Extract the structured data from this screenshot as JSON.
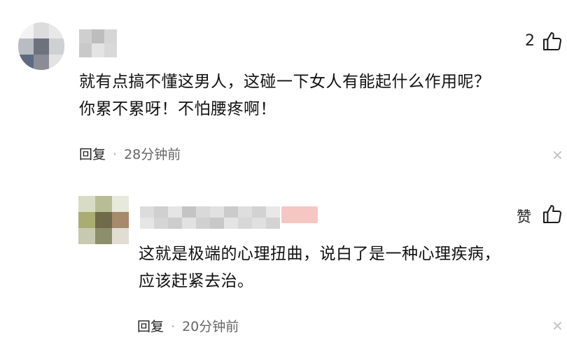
{
  "comment": {
    "like_count": "2",
    "text_line1": "就有点搞不懂这男人，这碰一下女人有能起什么作用呢？",
    "text_line2": "你累不累呀！不怕腰疼啊！",
    "reply_label": "回复",
    "time": "28分钟前"
  },
  "reply": {
    "like_label": "赞",
    "text_line1": "这就是极端的心理扭曲，说白了是一种心理疾病，",
    "text_line2": "应该赶紧去治。",
    "reply_label": "回复",
    "time": "20分钟前"
  },
  "icons": {
    "like": "thumbs-up-icon",
    "close": "close-icon"
  },
  "colors": {
    "text": "#111111",
    "meta_time": "#666666",
    "close": "#c4c4c4"
  }
}
